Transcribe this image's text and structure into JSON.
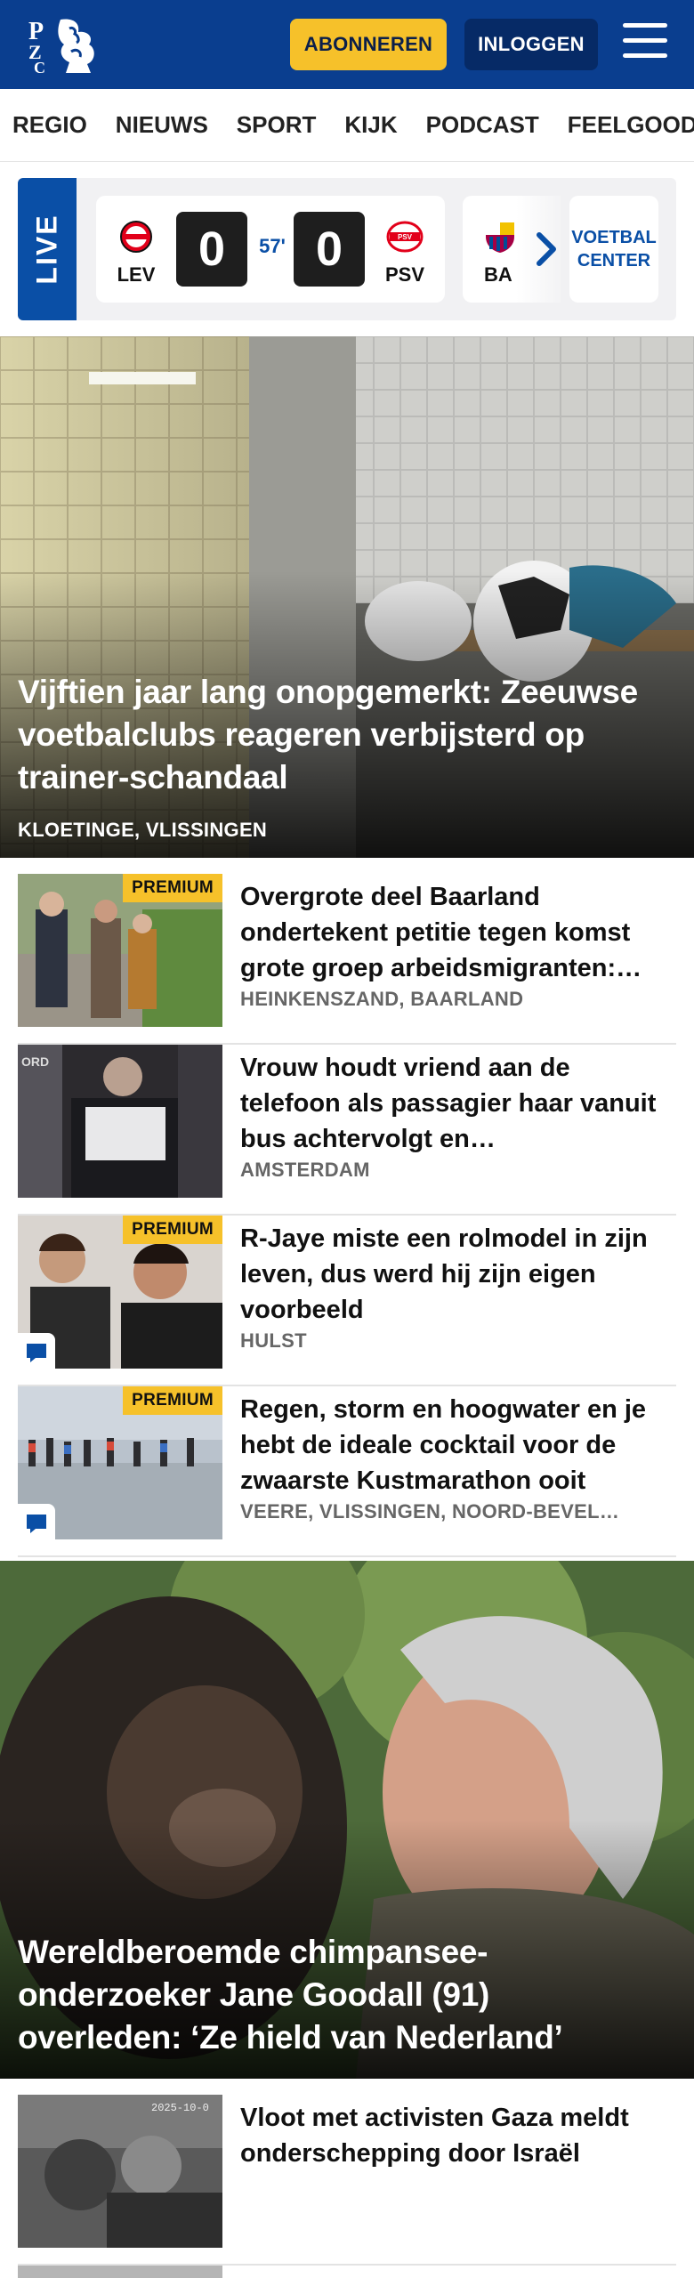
{
  "header": {
    "logo_text": "PZC",
    "subscribe_label": "ABONNEREN",
    "login_label": "INLOGGEN"
  },
  "nav": {
    "items": [
      "REGIO",
      "NIEUWS",
      "SPORT",
      "KIJK",
      "PODCAST",
      "FEELGOOD"
    ]
  },
  "live": {
    "label": "LIVE",
    "match": {
      "home": "LEV",
      "away": "PSV",
      "home_score": "0",
      "away_score": "0",
      "minute": "57'"
    },
    "next_match_team": "BA",
    "voetbal_center": "VOETBAL CENTER"
  },
  "hero1": {
    "title": "Vijftien jaar lang onopgemerkt: Zeeuwse voetbalclubs reageren verbijsterd op trainer-schandaal",
    "location": "KLOETINGE, VLISSINGEN"
  },
  "articles": [
    {
      "title": "Overgrote deel Baarland ondertekent petitie tegen komst grote groep arbeidsmigranten:…",
      "location": "HEINKENSZAND, BAARLAND",
      "premium": "PREMIUM",
      "comments": false
    },
    {
      "title": "Vrouw houdt vriend aan de telefoon als passagier haar vanuit bus achtervolgt en…",
      "location": "AMSTERDAM",
      "premium": "",
      "comments": false
    },
    {
      "title": "R-Jaye miste een rolmodel in zijn leven, dus werd hij zijn eigen voorbeeld",
      "location": "HULST",
      "premium": "PREMIUM",
      "comments": true
    },
    {
      "title": "Regen, storm en hoogwater en je hebt de ideale cocktail voor de zwaarste Kustmarathon ooit",
      "location": "VEERE, VLISSINGEN, NOORD-BEVEL…",
      "premium": "PREMIUM",
      "comments": true
    }
  ],
  "hero2": {
    "title": "Wereldberoemde chimpansee-onderzoeker Jane Goodall (91) overleden: ‘Ze hield van Nederland’"
  },
  "articles2": [
    {
      "title": "Vloot met activisten Gaza meldt onderschepping door Israël"
    }
  ],
  "colors": {
    "brand_blue": "#0a3e8f",
    "accent_yellow": "#f6c12a",
    "live_blue": "#0a4fa6"
  }
}
